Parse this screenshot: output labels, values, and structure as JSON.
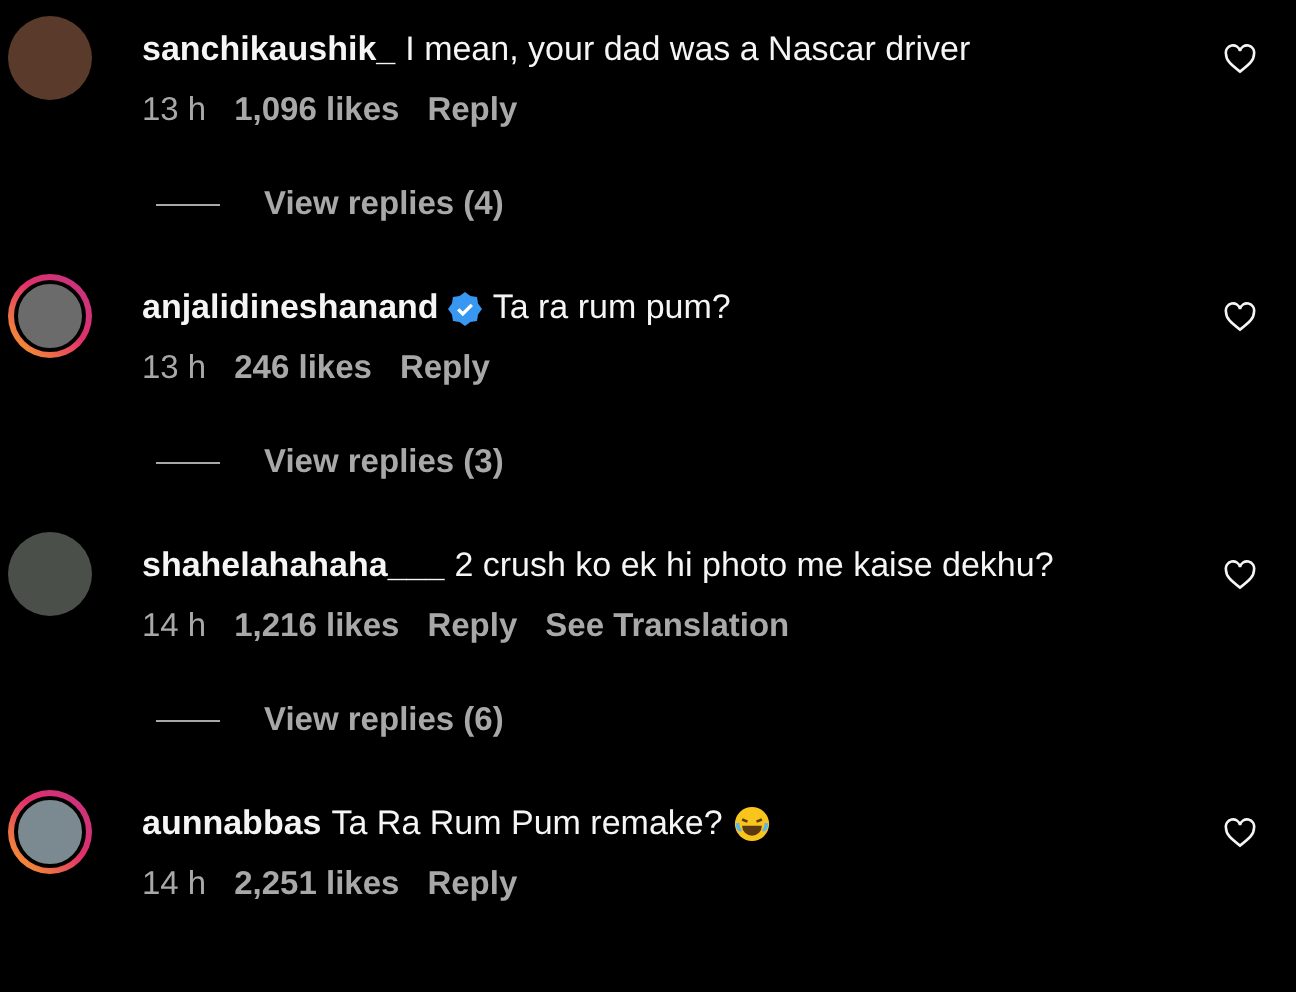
{
  "comments": [
    {
      "username": "sanchikaushik_",
      "verified": false,
      "story_ring": false,
      "text": "I mean, your dad was a Nascar driver",
      "emoji": false,
      "time": "13 h",
      "likes": "1,096 likes",
      "reply": "Reply",
      "view_replies": "View replies (4)"
    },
    {
      "username": "anjalidineshanand",
      "verified": true,
      "story_ring": true,
      "text": "Ta ra rum pum?",
      "emoji": false,
      "time": "13 h",
      "likes": "246 likes",
      "reply": "Reply",
      "view_replies": "View replies (3)"
    },
    {
      "username": "shahelahahaha___",
      "verified": false,
      "story_ring": false,
      "text": "2 crush ko ek hi photo me kaise dekhu?",
      "emoji": false,
      "time": "14 h",
      "likes": "1,216 likes",
      "reply": "Reply",
      "see_translation": "See Translation",
      "view_replies": "View replies (6)"
    },
    {
      "username": "aunnabbas",
      "verified": false,
      "story_ring": true,
      "text": "Ta Ra Rum Pum remake?",
      "emoji": true,
      "time": "14 h",
      "likes": "2,251 likes",
      "reply": "Reply"
    }
  ]
}
